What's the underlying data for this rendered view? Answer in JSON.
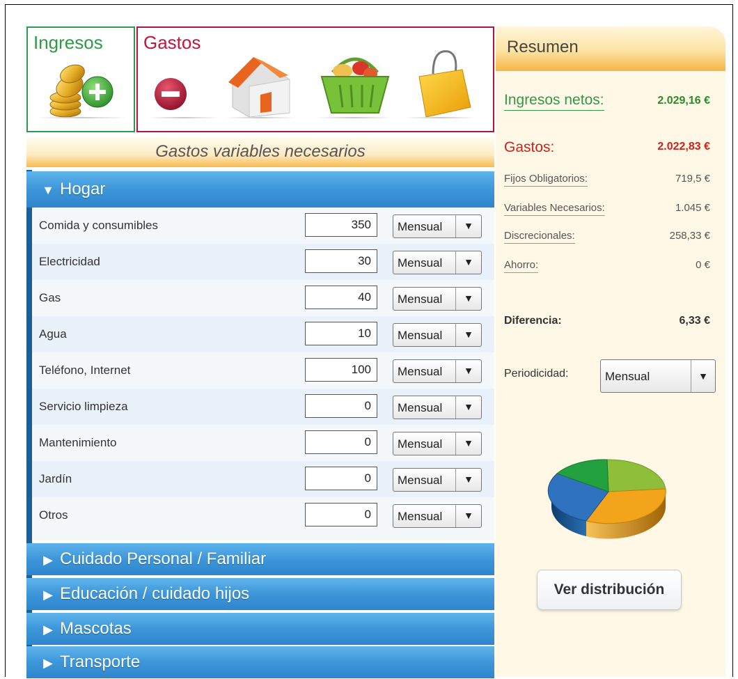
{
  "categories": {
    "ingresos": {
      "title": "Ingresos",
      "icon": "coins-add-icon"
    },
    "gastos": {
      "title": "Gastos",
      "icons": [
        "minus-circle-icon",
        "house-icon",
        "shopping-basket-icon",
        "shopping-bag-icon"
      ]
    }
  },
  "section_header": "Gastos variables necesarios",
  "groups": {
    "hogar": "Hogar",
    "cuidado": "Cuidado Personal / Familiar",
    "educacion": "Educación / cuidado hijos",
    "mascotas": "Mascotas",
    "transporte": "Transporte"
  },
  "rows": [
    {
      "label": "Comida y consumibles",
      "amount": "350",
      "period": "Mensual"
    },
    {
      "label": "Electricidad",
      "amount": "30",
      "period": "Mensual"
    },
    {
      "label": "Gas",
      "amount": "40",
      "period": "Mensual"
    },
    {
      "label": "Agua",
      "amount": "10",
      "period": "Mensual"
    },
    {
      "label": "Teléfono, Internet",
      "amount": "100",
      "period": "Mensual"
    },
    {
      "label": "Servicio limpieza",
      "amount": "0",
      "period": "Mensual"
    },
    {
      "label": "Mantenimiento",
      "amount": "0",
      "period": "Mensual"
    },
    {
      "label": "Jardín",
      "amount": "0",
      "period": "Mensual"
    },
    {
      "label": "Otros",
      "amount": "0",
      "period": "Mensual"
    }
  ],
  "summary": {
    "title": "Resumen",
    "ingresos_label": "Ingresos netos:",
    "ingresos_value": "2.029,16 €",
    "gastos_label": "Gastos:",
    "gastos_value": "2.022,83 €",
    "fijos_label": "Fijos Obligatorios:",
    "fijos_value": "719,5 €",
    "variables_label": "Variables Necesarios:",
    "variables_value": "1.045 €",
    "discrecionales_label": "Discrecionales:",
    "discrecionales_value": "258,33 €",
    "ahorro_label": "Ahorro:",
    "ahorro_value": "0 €",
    "diferencia_label": "Diferencia:",
    "diferencia_value": "6,33 €",
    "periodicidad_label": "Periodicidad:",
    "periodicidad_value": "Mensual",
    "ver_button": "Ver distribución"
  },
  "colors": {
    "income_green": "#2e9a46",
    "expense_red": "#c0173c",
    "accordion_blue": "#3d96d9",
    "summary_bg": "#fff8e6",
    "gastos_value_red": "#d0201a"
  }
}
